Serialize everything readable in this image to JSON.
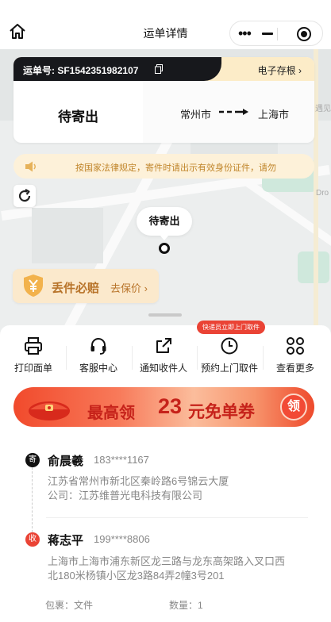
{
  "nav": {
    "title": "运单详情",
    "home_icon": "home-icon",
    "menu_icon": "more-dots-icon",
    "minimize_icon": "minimize-icon",
    "close_icon": "target-close-icon"
  },
  "waybill": {
    "number_label": "运单号: SF1542351982107",
    "e_receipt_label": "电子存根 ›",
    "status": "待寄出",
    "from_city": "常州市",
    "to_city": "上海市"
  },
  "notice": {
    "text": "按国家法律规定，寄件时请出示有效身份证件，请勿"
  },
  "map": {
    "bubble_status": "待寄出",
    "insurance_title": "丢件必赔",
    "insurance_link": "去保价 ›",
    "edge_label_1": "遇见",
    "edge_label_2": "Dro"
  },
  "actions": {
    "tooltip": "快递员立即上门取件",
    "items": [
      {
        "label": "打印面单",
        "icon": "printer-icon"
      },
      {
        "label": "客服中心",
        "icon": "headset-icon"
      },
      {
        "label": "通知收件人",
        "icon": "share-icon"
      },
      {
        "label": "预约上门取件",
        "icon": "clock-icon"
      },
      {
        "label": "查看更多",
        "icon": "grid-icon"
      }
    ]
  },
  "coupon": {
    "prefix": "最高领",
    "amount": "23",
    "suffix": "元免单券",
    "button": "领"
  },
  "sender": {
    "badge": "寄",
    "name": "俞晨羲",
    "phone": "183****1167",
    "address": "江苏省常州市新北区秦岭路6号锦云大厦",
    "company": "公司：江苏维普光电科技有限公司"
  },
  "receiver": {
    "badge": "收",
    "name": "蒋志平",
    "phone": "199****8806",
    "address_line1": "上海市上海市浦东新区龙三路与龙东高架路入叉口西",
    "address_line2": "北180米杨镇小区龙3路84弄2幢3号201"
  },
  "package": {
    "package_label": "包裹：文件",
    "quantity_label": "数量：1"
  },
  "colors": {
    "accent_red": "#ea4335",
    "coupon_text": "#c6221a",
    "notice_text": "#c0852a",
    "header_dark": "#17181c"
  }
}
